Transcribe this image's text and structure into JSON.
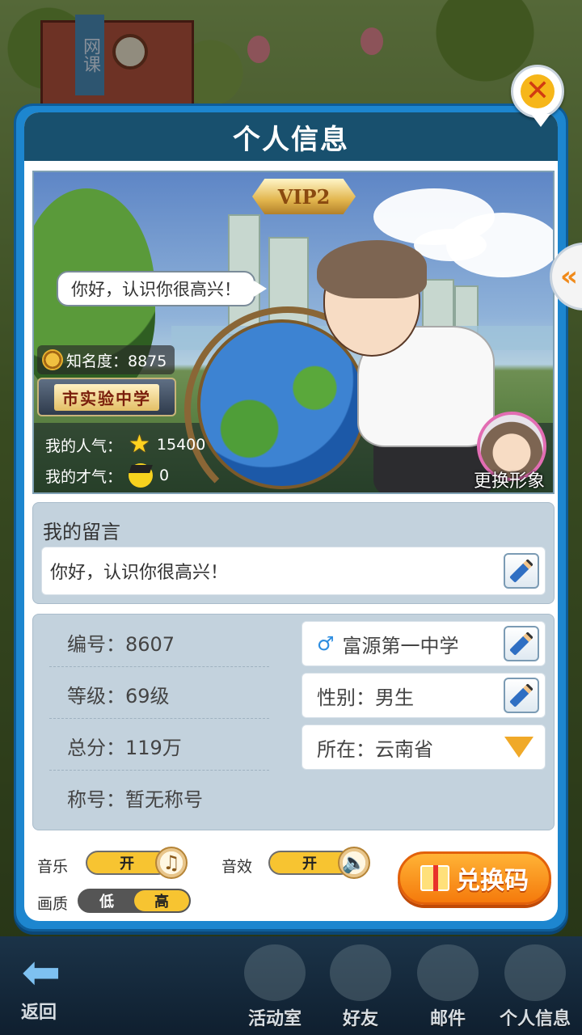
{
  "background": {
    "building_sign": "网课"
  },
  "modal": {
    "title": "个人信息"
  },
  "profile": {
    "vip_badge": "VIP2",
    "greeting_bubble": "你好，认识你很高兴！",
    "fame_label": "知名度：8875",
    "school_badge": "市实验中学",
    "popularity_label": "我的人气：",
    "popularity_value": "15400",
    "talent_label": "我的才气：",
    "talent_value": "0",
    "change_avatar_label": "更换形象"
  },
  "message": {
    "title": "我的留言",
    "text": "你好，认识你很高兴！"
  },
  "info": {
    "id": "编号：8607",
    "level": "等级：69级",
    "score": "总分：119万",
    "title": "称号：暂无称号",
    "school": "富源第一中学",
    "gender": "性别：男生",
    "location": "所在：云南省"
  },
  "settings": {
    "music_label": "音乐",
    "music_state": "开",
    "sfx_label": "音效",
    "sfx_state": "开",
    "quality_label": "画质",
    "quality_low": "低",
    "quality_high": "高",
    "redeem_button": "兑换码"
  },
  "side_tab": {
    "icon": "double-chevron-left-icon",
    "glyph": "«"
  },
  "nav": {
    "back": "返回",
    "items": [
      {
        "label": "活动室",
        "icon": "activity-room-icon"
      },
      {
        "label": "好友",
        "icon": "friends-icon"
      },
      {
        "label": "邮件",
        "icon": "mail-icon"
      },
      {
        "label": "个人信息",
        "icon": "profile-icon"
      }
    ]
  },
  "colors": {
    "modal_blue": "#1d86cf",
    "header_navy": "#18506e",
    "toggle_yellow": "#f7c431",
    "redeem_orange": "#f57a0c"
  }
}
